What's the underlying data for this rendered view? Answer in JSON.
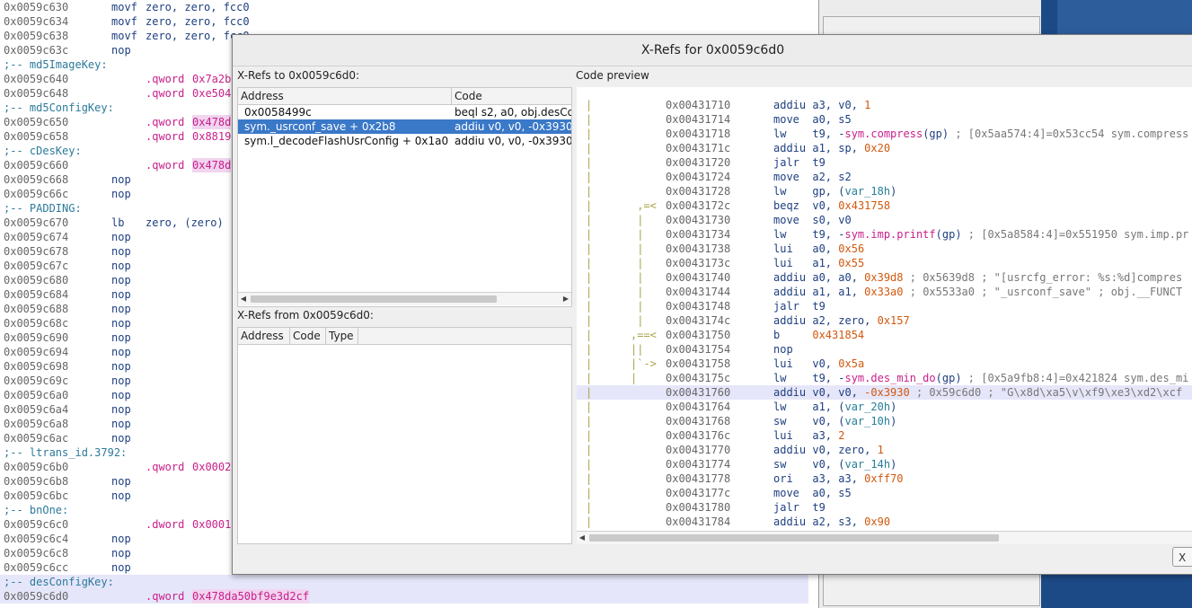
{
  "disasm": {
    "lines": [
      {
        "type": "ins",
        "addr": "0x0059c630",
        "mn": "movf",
        "ops": "zero, zero, fcc0"
      },
      {
        "type": "ins",
        "addr": "0x0059c634",
        "mn": "movf",
        "ops": "zero, zero, fcc0"
      },
      {
        "type": "ins",
        "addr": "0x0059c638",
        "mn": "movf",
        "ops": "zero, zero, fcc0"
      },
      {
        "type": "ins",
        "addr": "0x0059c63c",
        "mn": "nop",
        "ops": ""
      },
      {
        "type": "label",
        "text": ";-- md5ImageKey:"
      },
      {
        "type": "data",
        "addr": "0x0059c640",
        "dir": ".qword",
        "val": "0x7a2b",
        "hl": false
      },
      {
        "type": "data",
        "addr": "0x0059c648",
        "dir": ".qword",
        "val": "0xe504",
        "hl": false
      },
      {
        "type": "label",
        "text": ";-- md5ConfigKey:"
      },
      {
        "type": "data",
        "addr": "0x0059c650",
        "dir": ".qword",
        "val": "0x478d",
        "hl": true
      },
      {
        "type": "data",
        "addr": "0x0059c658",
        "dir": ".qword",
        "val": "0x8819",
        "hl": false
      },
      {
        "type": "label",
        "text": ";-- cDesKey:"
      },
      {
        "type": "data",
        "addr": "0x0059c660",
        "dir": ".qword",
        "val": "0x478d",
        "hl": true
      },
      {
        "type": "ins",
        "addr": "0x0059c668",
        "mn": "nop",
        "ops": ""
      },
      {
        "type": "ins",
        "addr": "0x0059c66c",
        "mn": "nop",
        "ops": ""
      },
      {
        "type": "label",
        "text": ";-- PADDING:"
      },
      {
        "type": "ins",
        "addr": "0x0059c670",
        "mn": "lb",
        "ops": "zero, (zero)"
      },
      {
        "type": "ins",
        "addr": "0x0059c674",
        "mn": "nop",
        "ops": ""
      },
      {
        "type": "ins",
        "addr": "0x0059c678",
        "mn": "nop",
        "ops": ""
      },
      {
        "type": "ins",
        "addr": "0x0059c67c",
        "mn": "nop",
        "ops": ""
      },
      {
        "type": "ins",
        "addr": "0x0059c680",
        "mn": "nop",
        "ops": ""
      },
      {
        "type": "ins",
        "addr": "0x0059c684",
        "mn": "nop",
        "ops": ""
      },
      {
        "type": "ins",
        "addr": "0x0059c688",
        "mn": "nop",
        "ops": ""
      },
      {
        "type": "ins",
        "addr": "0x0059c68c",
        "mn": "nop",
        "ops": ""
      },
      {
        "type": "ins",
        "addr": "0x0059c690",
        "mn": "nop",
        "ops": ""
      },
      {
        "type": "ins",
        "addr": "0x0059c694",
        "mn": "nop",
        "ops": ""
      },
      {
        "type": "ins",
        "addr": "0x0059c698",
        "mn": "nop",
        "ops": ""
      },
      {
        "type": "ins",
        "addr": "0x0059c69c",
        "mn": "nop",
        "ops": ""
      },
      {
        "type": "ins",
        "addr": "0x0059c6a0",
        "mn": "nop",
        "ops": ""
      },
      {
        "type": "ins",
        "addr": "0x0059c6a4",
        "mn": "nop",
        "ops": ""
      },
      {
        "type": "ins",
        "addr": "0x0059c6a8",
        "mn": "nop",
        "ops": ""
      },
      {
        "type": "ins",
        "addr": "0x0059c6ac",
        "mn": "nop",
        "ops": ""
      },
      {
        "type": "label",
        "text": ";-- ltrans_id.3792:"
      },
      {
        "type": "data",
        "addr": "0x0059c6b0",
        "dir": ".qword",
        "val": "0x0002",
        "hl": false
      },
      {
        "type": "ins",
        "addr": "0x0059c6b8",
        "mn": "nop",
        "ops": ""
      },
      {
        "type": "ins",
        "addr": "0x0059c6bc",
        "mn": "nop",
        "ops": ""
      },
      {
        "type": "label",
        "text": ";-- bnOne:"
      },
      {
        "type": "data",
        "addr": "0x0059c6c0",
        "dir": ".dword",
        "val": "0x0001",
        "hl": false
      },
      {
        "type": "ins",
        "addr": "0x0059c6c4",
        "mn": "nop",
        "ops": ""
      },
      {
        "type": "ins",
        "addr": "0x0059c6c8",
        "mn": "nop",
        "ops": ""
      },
      {
        "type": "ins",
        "addr": "0x0059c6cc",
        "mn": "nop",
        "ops": ""
      },
      {
        "type": "label",
        "text": ";-- desConfigKey:",
        "current": true
      },
      {
        "type": "data",
        "addr": "0x0059c6d0",
        "dir": ".qword",
        "val": "0x478da50bf9e3d2cf",
        "hl": true,
        "current": true
      }
    ]
  },
  "dialog": {
    "title": "X-Refs for 0x0059c6d0",
    "xrefs_to_label": "X-Refs to 0x0059c6d0:",
    "xrefs_to_columns": [
      "Address",
      "Code"
    ],
    "xrefs_to_rows": [
      {
        "address": "0x0058499c",
        "code": "beql s2, a0, obj.desCo",
        "selected": false
      },
      {
        "address": "sym._usrconf_save + 0x2b8",
        "code": "addiu v0, v0, -0x3930",
        "selected": true
      },
      {
        "address": "sym.l_decodeFlashUsrConfig + 0x1a0",
        "code": "addiu v0, v0, -0x3930",
        "selected": false
      }
    ],
    "xrefs_from_label": "X-Refs from 0x0059c6d0:",
    "xrefs_from_columns": [
      "Address",
      "Code",
      "Type"
    ],
    "code_preview_label": "Code preview",
    "close_label": "X"
  },
  "code_preview": {
    "lines": [
      {
        "flow": "",
        "addr": "0x00431710",
        "mn": "addiu",
        "ops": [
          [
            "reg",
            "a3, v0, "
          ],
          [
            "num",
            "1"
          ]
        ]
      },
      {
        "flow": "",
        "addr": "0x00431714",
        "mn": "move",
        "ops": [
          [
            "reg",
            "a0, s5"
          ]
        ]
      },
      {
        "flow": "",
        "addr": "0x00431718",
        "mn": "lw",
        "ops": [
          [
            "reg",
            "t9, -"
          ],
          [
            "sym",
            "sym.compress"
          ],
          [
            "reg",
            "(gp)"
          ],
          [
            "cmt",
            " ; [0x5aa574:4]=0x53cc54 sym.compress"
          ]
        ]
      },
      {
        "flow": "",
        "addr": "0x0043171c",
        "mn": "addiu",
        "ops": [
          [
            "reg",
            "a1, sp, "
          ],
          [
            "num",
            "0x20"
          ]
        ]
      },
      {
        "flow": "",
        "addr": "0x00431720",
        "mn": "jalr",
        "ops": [
          [
            "reg",
            "t9"
          ]
        ]
      },
      {
        "flow": "",
        "addr": "0x00431724",
        "mn": "move",
        "ops": [
          [
            "reg",
            "a2, s2"
          ]
        ]
      },
      {
        "flow": "",
        "addr": "0x00431728",
        "mn": "lw",
        "ops": [
          [
            "reg",
            "gp, ("
          ],
          [
            "ident",
            "var_18h"
          ],
          [
            "reg",
            ")"
          ]
        ]
      },
      {
        "flow": " ,=<",
        "addr": "0x0043172c",
        "mn": "beqz",
        "ops": [
          [
            "reg",
            "v0, "
          ],
          [
            "num",
            "0x431758"
          ]
        ]
      },
      {
        "flow": " |",
        "addr": "0x00431730",
        "mn": "move",
        "ops": [
          [
            "reg",
            "s0, v0"
          ]
        ]
      },
      {
        "flow": " |",
        "addr": "0x00431734",
        "mn": "lw",
        "ops": [
          [
            "reg",
            "t9, -"
          ],
          [
            "sym",
            "sym.imp.printf"
          ],
          [
            "reg",
            "(gp)"
          ],
          [
            "cmt",
            " ; [0x5a8584:4]=0x551950 sym.imp.pr"
          ]
        ]
      },
      {
        "flow": " |",
        "addr": "0x00431738",
        "mn": "lui",
        "ops": [
          [
            "reg",
            "a0, "
          ],
          [
            "num",
            "0x56"
          ]
        ]
      },
      {
        "flow": " |",
        "addr": "0x0043173c",
        "mn": "lui",
        "ops": [
          [
            "reg",
            "a1, "
          ],
          [
            "num",
            "0x55"
          ]
        ]
      },
      {
        "flow": " |",
        "addr": "0x00431740",
        "mn": "addiu",
        "ops": [
          [
            "reg",
            "a0, a0, "
          ],
          [
            "num",
            "0x39d8"
          ],
          [
            "cmt",
            " ; 0x5639d8 ; \"[usrcfg_error: %s:%d]compres"
          ]
        ]
      },
      {
        "flow": " |",
        "addr": "0x00431744",
        "mn": "addiu",
        "ops": [
          [
            "reg",
            "a1, a1, "
          ],
          [
            "num",
            "0x33a0"
          ],
          [
            "cmt",
            " ; 0x5533a0 ; \"_usrconf_save\" ; obj.__FUNCT"
          ]
        ]
      },
      {
        "flow": " |",
        "addr": "0x00431748",
        "mn": "jalr",
        "ops": [
          [
            "reg",
            "t9"
          ]
        ]
      },
      {
        "flow": " |",
        "addr": "0x0043174c",
        "mn": "addiu",
        "ops": [
          [
            "reg",
            "a2, zero, "
          ],
          [
            "num",
            "0x157"
          ]
        ]
      },
      {
        "flow": ",==<",
        "addr": "0x00431750",
        "mn": "b",
        "ops": [
          [
            "num",
            "0x431854"
          ]
        ]
      },
      {
        "flow": "||",
        "addr": "0x00431754",
        "mn": "nop",
        "ops": []
      },
      {
        "flow": "|`->",
        "addr": "0x00431758",
        "mn": "lui",
        "ops": [
          [
            "reg",
            "v0, "
          ],
          [
            "num",
            "0x5a"
          ]
        ]
      },
      {
        "flow": "|",
        "addr": "0x0043175c",
        "mn": "lw",
        "ops": [
          [
            "reg",
            "t9, -"
          ],
          [
            "sym",
            "sym.des_min_do"
          ],
          [
            "reg",
            "(gp)"
          ],
          [
            "cmt",
            " ; [0x5a9fb8:4]=0x421824 sym.des_mi"
          ]
        ]
      },
      {
        "flow": "",
        "addr": "0x00431760",
        "mn": "addiu",
        "ops": [
          [
            "reg",
            "v0, v0, "
          ],
          [
            "num",
            "-0x3930"
          ],
          [
            "cmt",
            " ; 0x59c6d0 ; \"G\\x8d\\xa5\\v\\xf9\\xe3\\xd2\\xcf"
          ]
        ],
        "current": true
      },
      {
        "flow": "",
        "addr": "0x00431764",
        "mn": "lw",
        "ops": [
          [
            "reg",
            "a1, ("
          ],
          [
            "ident",
            "var_20h"
          ],
          [
            "reg",
            ")"
          ]
        ]
      },
      {
        "flow": "",
        "addr": "0x00431768",
        "mn": "sw",
        "ops": [
          [
            "reg",
            "v0, ("
          ],
          [
            "ident",
            "var_10h"
          ],
          [
            "reg",
            ")"
          ]
        ]
      },
      {
        "flow": "",
        "addr": "0x0043176c",
        "mn": "lui",
        "ops": [
          [
            "reg",
            "a3, "
          ],
          [
            "num",
            "2"
          ]
        ]
      },
      {
        "flow": "",
        "addr": "0x00431770",
        "mn": "addiu",
        "ops": [
          [
            "reg",
            "v0, zero, "
          ],
          [
            "num",
            "1"
          ]
        ]
      },
      {
        "flow": "",
        "addr": "0x00431774",
        "mn": "sw",
        "ops": [
          [
            "reg",
            "v0, ("
          ],
          [
            "ident",
            "var_14h"
          ],
          [
            "reg",
            ")"
          ]
        ]
      },
      {
        "flow": "",
        "addr": "0x00431778",
        "mn": "ori",
        "ops": [
          [
            "reg",
            "a3, a3, "
          ],
          [
            "num",
            "0xff70"
          ]
        ]
      },
      {
        "flow": "",
        "addr": "0x0043177c",
        "mn": "move",
        "ops": [
          [
            "reg",
            "a0, s5"
          ]
        ]
      },
      {
        "flow": "",
        "addr": "0x00431780",
        "mn": "jalr",
        "ops": [
          [
            "reg",
            "t9"
          ]
        ]
      },
      {
        "flow": "",
        "addr": "0x00431784",
        "mn": "addiu",
        "ops": [
          [
            "reg",
            "a2, s3, "
          ],
          [
            "num",
            "0x90"
          ]
        ]
      }
    ]
  }
}
